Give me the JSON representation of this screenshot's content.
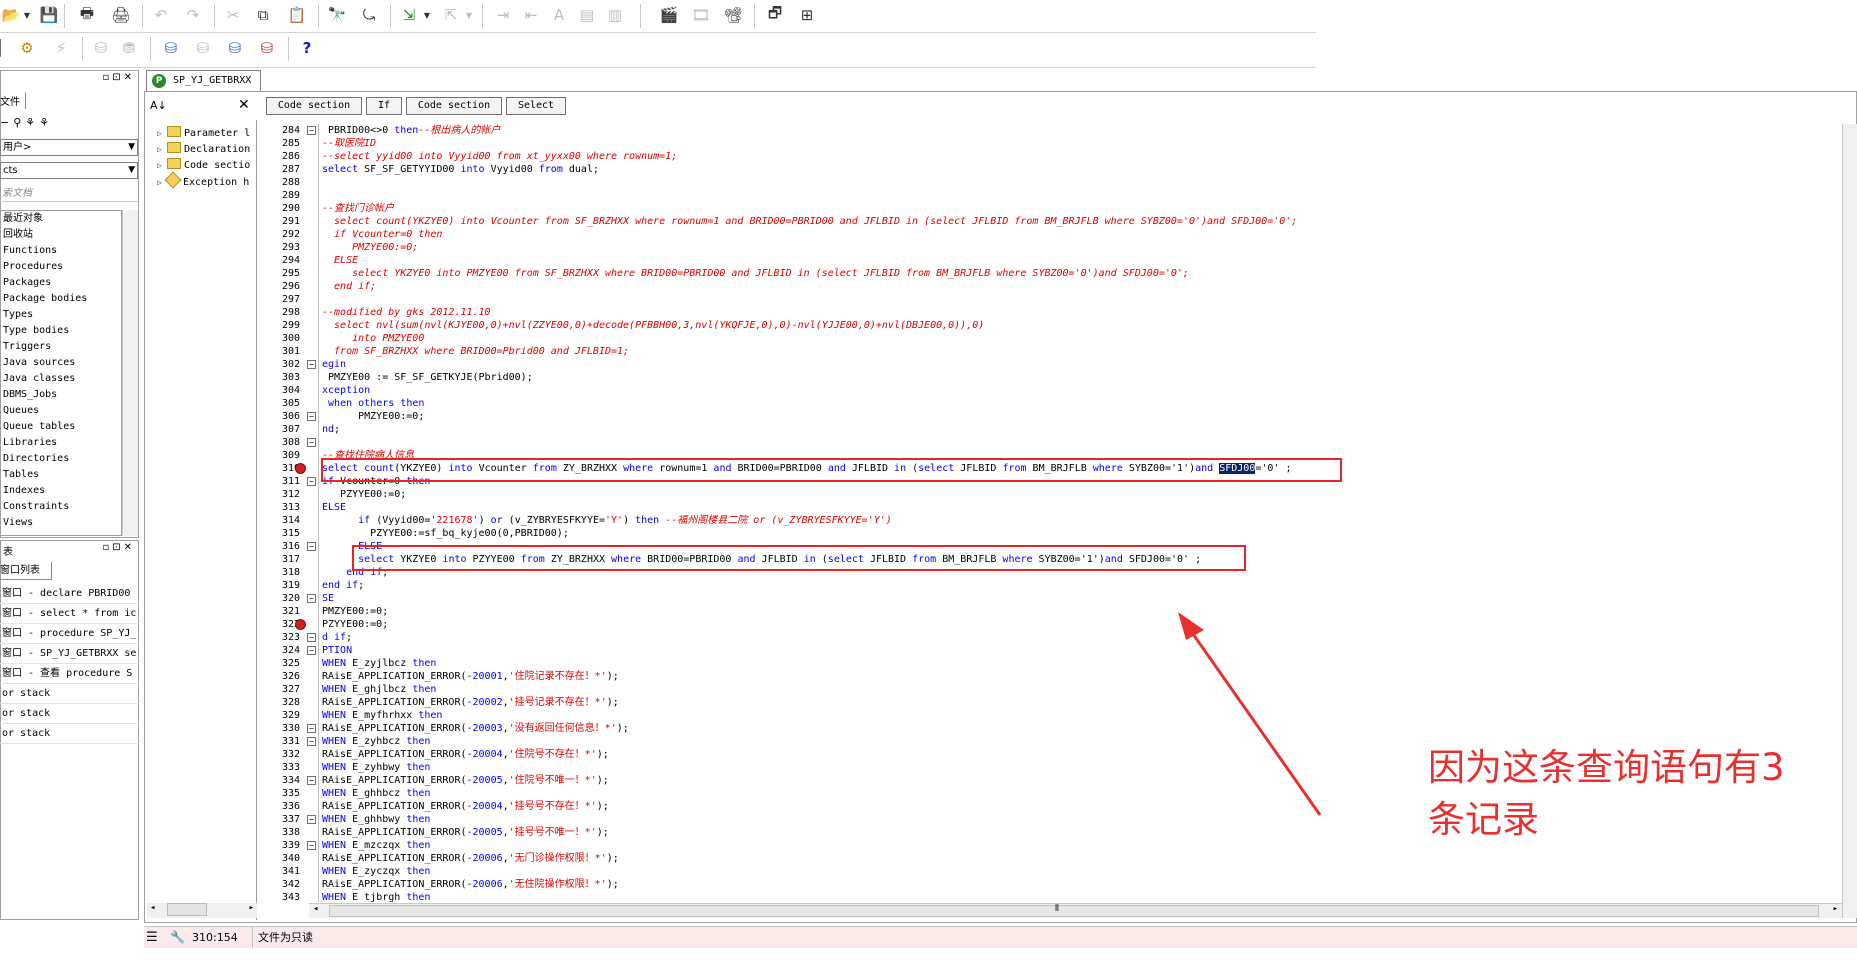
{
  "editor": {
    "tab_title": "SP_YJ_GETBRXX",
    "section_buttons": [
      "Code section",
      "If",
      "Code section",
      "Select"
    ],
    "line_numbers": [
      "284",
      "285",
      "286",
      "287",
      "288",
      "289",
      "290",
      "291",
      "292",
      "293",
      "294",
      "295",
      "296",
      "297",
      "298",
      "299",
      "300",
      "301",
      "302",
      "303",
      "304",
      "305",
      "306",
      "307",
      "308",
      "309",
      "310",
      "311",
      "312",
      "313",
      "314",
      "315",
      "316",
      "317",
      "318",
      "319",
      "320",
      "321",
      "322",
      "323",
      "324",
      "325",
      "326",
      "327",
      "328",
      "329",
      "330",
      "331",
      "332",
      "333",
      "334",
      "335",
      "336",
      "337",
      "338",
      "339",
      "340",
      "341",
      "342",
      "343"
    ]
  },
  "sidebar": {
    "tab_label": "文件",
    "user_combo": "用户>",
    "type_combo": "cts",
    "search_placeholder": "索文档",
    "objects": [
      "最近对象",
      "回收站",
      "Functions",
      "Procedures",
      "Packages",
      "Package bodies",
      "Types",
      "Type bodies",
      "Triggers",
      "Java sources",
      "Java classes",
      "DBMS_Jobs",
      "Queues",
      "Queue tables",
      "Libraries",
      "Directories",
      "Tables",
      "Indexes",
      "Constraints",
      "Views"
    ],
    "windows_title": "表",
    "windows_tab": "窗口列表",
    "windows": [
      "窗口 - declare PBRID00",
      "窗口 - select * from ic",
      "窗口 - procedure SP_YJ_",
      "窗口 - SP_YJ_GETBRXX se",
      "窗口 - 查看 procedure S"
    ],
    "stacks": [
      "or stack",
      "or stack",
      "or stack"
    ]
  },
  "tree": {
    "nodes": [
      "Parameter l",
      "Declaration",
      "Code sectio",
      "Exception h"
    ]
  },
  "status": {
    "position": "310:154",
    "message": "文件为只读"
  },
  "annotation": {
    "line1": "因为这条查询语句有3",
    "line2": "条记录"
  }
}
